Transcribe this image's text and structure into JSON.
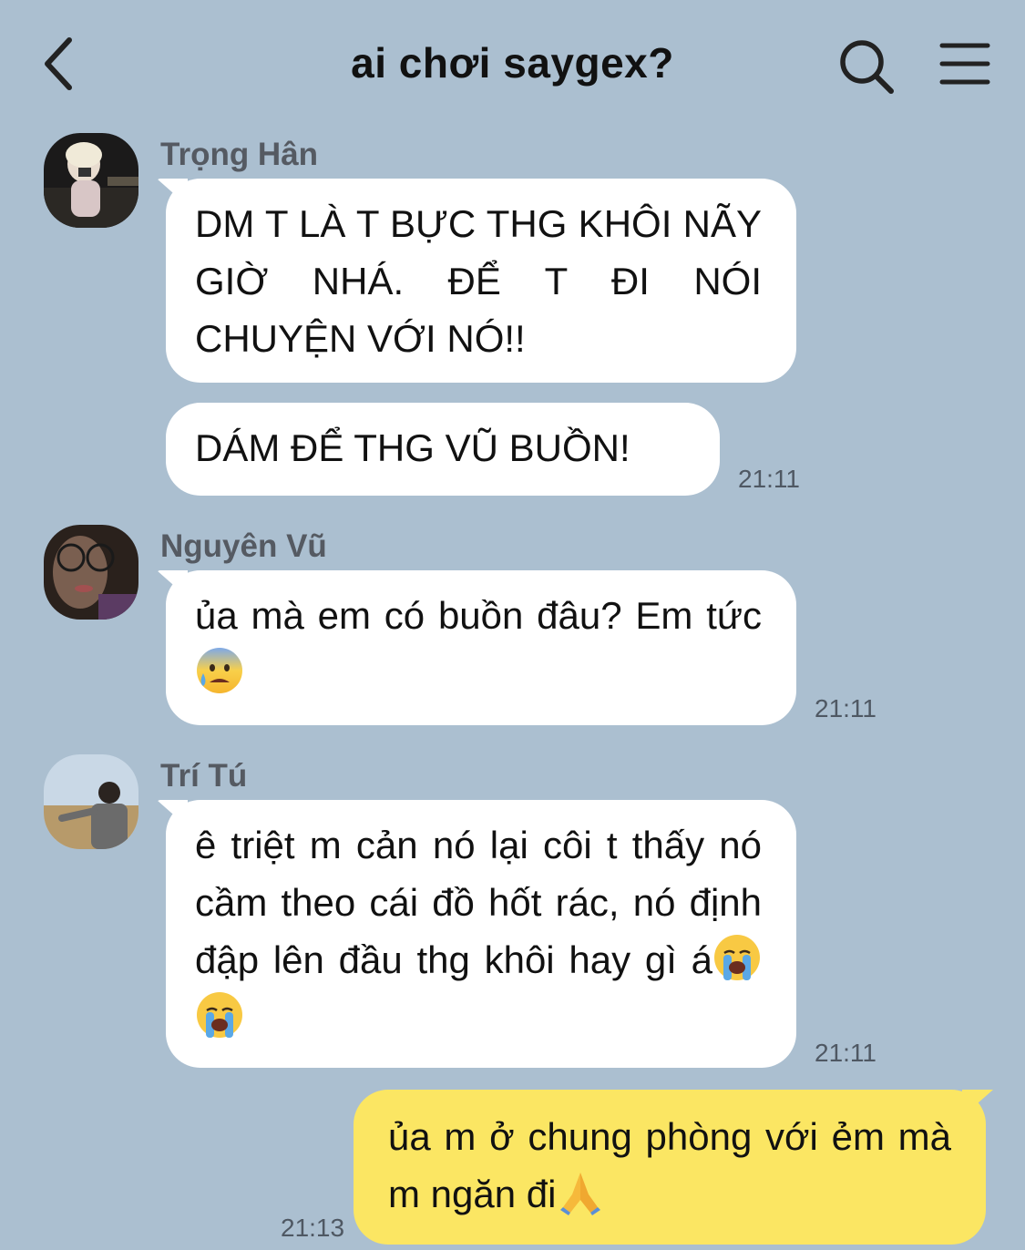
{
  "header": {
    "title": "ai chơi saygex?",
    "back_icon": "chevron-left-icon",
    "search_icon": "search-icon",
    "menu_icon": "hamburger-menu-icon"
  },
  "colors": {
    "background": "#abbfd0",
    "incoming_bubble": "#ffffff",
    "outgoing_bubble": "#fbe663",
    "sender_name": "#555a62",
    "timestamp": "#4f5863"
  },
  "messages": [
    {
      "sender": "Trọng Hân",
      "bubbles": [
        "DM T LÀ T BỰC THG KHÔI NÃY GIỜ NHÁ. ĐỂ T ĐI NÓI CHUYỆN VỚI NÓ!!",
        "DÁM ĐỂ THG VŨ BUỒN!"
      ],
      "time": "21:11"
    },
    {
      "sender": "Nguyên Vũ",
      "text": "ủa mà em có buồn đâu? Em tức",
      "emoji": "anxious-sweat-face-emoji",
      "time": "21:11"
    },
    {
      "sender": "Trí Tú",
      "text": "ê triệt m cản nó lại côi t thấy nó cầm theo cái đồ hốt rác, nó định đập lên đầu thg khôi hay gì á",
      "emoji": "loudly-crying-face-emoji",
      "time": "21:11"
    },
    {
      "sender": "me",
      "text": "ủa m ở chung phòng với ẻm mà m ngăn đi",
      "emoji": "folded-hands-emoji",
      "time": "21:13"
    }
  ]
}
